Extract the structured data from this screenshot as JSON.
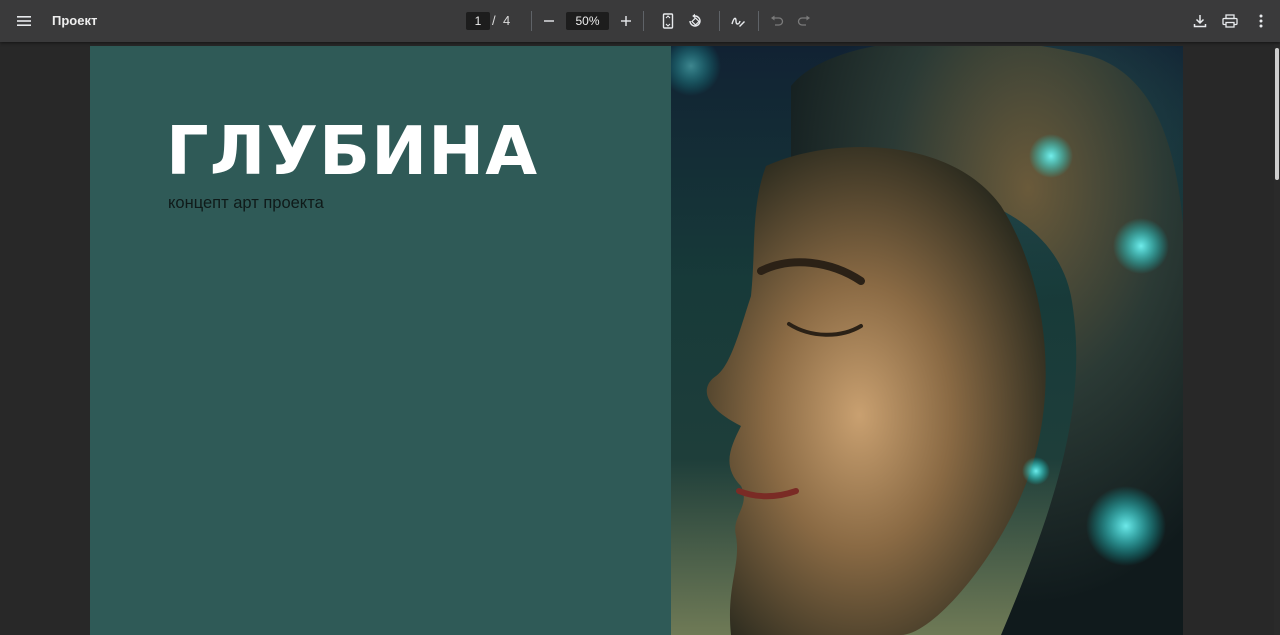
{
  "toolbar": {
    "title": "Проект",
    "current_page": "1",
    "page_separator": "/",
    "total_pages": "4",
    "zoom": "50%"
  },
  "slide": {
    "title": "ГЛУБИНА",
    "subtitle": "концепт арт проекта",
    "background_color": "#2f5a57",
    "photo_description_icon": "portrait-image"
  }
}
